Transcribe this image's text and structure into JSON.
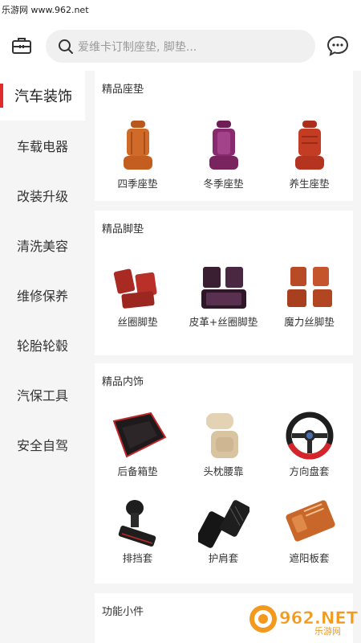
{
  "watermark": {
    "site": "乐游网 www.962.net",
    "logo_main": "962.NET",
    "logo_sub": "乐游网"
  },
  "header": {
    "search_placeholder": "爱维卡订制座垫, 脚垫...",
    "left_icon": "toolbox-icon",
    "right_icon": "chat-bubble-icon"
  },
  "sidebar": {
    "items": [
      {
        "label": "汽车装饰",
        "active": true
      },
      {
        "label": "车载电器",
        "active": false
      },
      {
        "label": "改装升级",
        "active": false
      },
      {
        "label": "清洗美容",
        "active": false
      },
      {
        "label": "维修保养",
        "active": false
      },
      {
        "label": "轮胎轮毂",
        "active": false
      },
      {
        "label": "汽保工具",
        "active": false
      },
      {
        "label": "安全自驾",
        "active": false
      }
    ]
  },
  "sections": [
    {
      "title": "精品座垫",
      "items": [
        {
          "label": "四季座垫"
        },
        {
          "label": "冬季座垫"
        },
        {
          "label": "养生座垫"
        }
      ]
    },
    {
      "title": "精品脚垫",
      "items": [
        {
          "label": "丝圈脚垫"
        },
        {
          "label": "皮革+丝圈脚垫"
        },
        {
          "label": "魔力丝脚垫"
        }
      ]
    },
    {
      "title": "精品内饰",
      "items": [
        {
          "label": "后备箱垫"
        },
        {
          "label": "头枕腰靠"
        },
        {
          "label": "方向盘套"
        },
        {
          "label": "排挡套"
        },
        {
          "label": "护肩套"
        },
        {
          "label": "遮阳板套"
        }
      ]
    },
    {
      "title": "功能小件",
      "items": []
    }
  ],
  "colors": {
    "accent": "#e02b2b",
    "logo_orange": "#f39a1e"
  }
}
